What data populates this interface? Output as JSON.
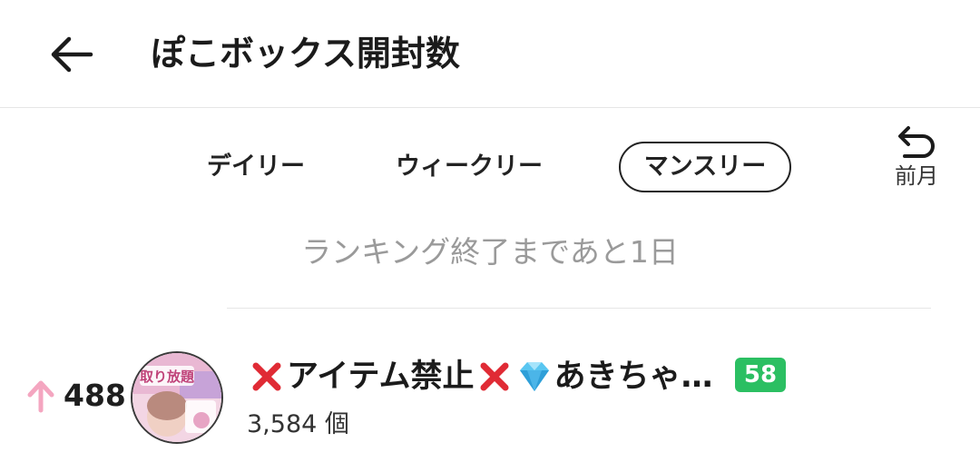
{
  "header": {
    "title": "ぽこボックス開封数",
    "back_icon": "arrow-left-icon"
  },
  "tabs": [
    {
      "label": "デイリー",
      "selected": false
    },
    {
      "label": "ウィークリー",
      "selected": false
    },
    {
      "label": "マンスリー",
      "selected": true
    }
  ],
  "prev_month": {
    "label": "前月",
    "icon": "undo-arrow-icon"
  },
  "remaining_text": "ランキング終了まであと1日",
  "ranking": [
    {
      "trend_icon": "arrow-up-icon",
      "trend_color": "#f4a6c0",
      "rank": "488",
      "name_part1": "アイテム禁止",
      "name_part2": "あきちゃ…",
      "level": "58",
      "level_color": "#2bbf62",
      "count": "3,584 個",
      "avatar_text": "取り放題"
    }
  ]
}
